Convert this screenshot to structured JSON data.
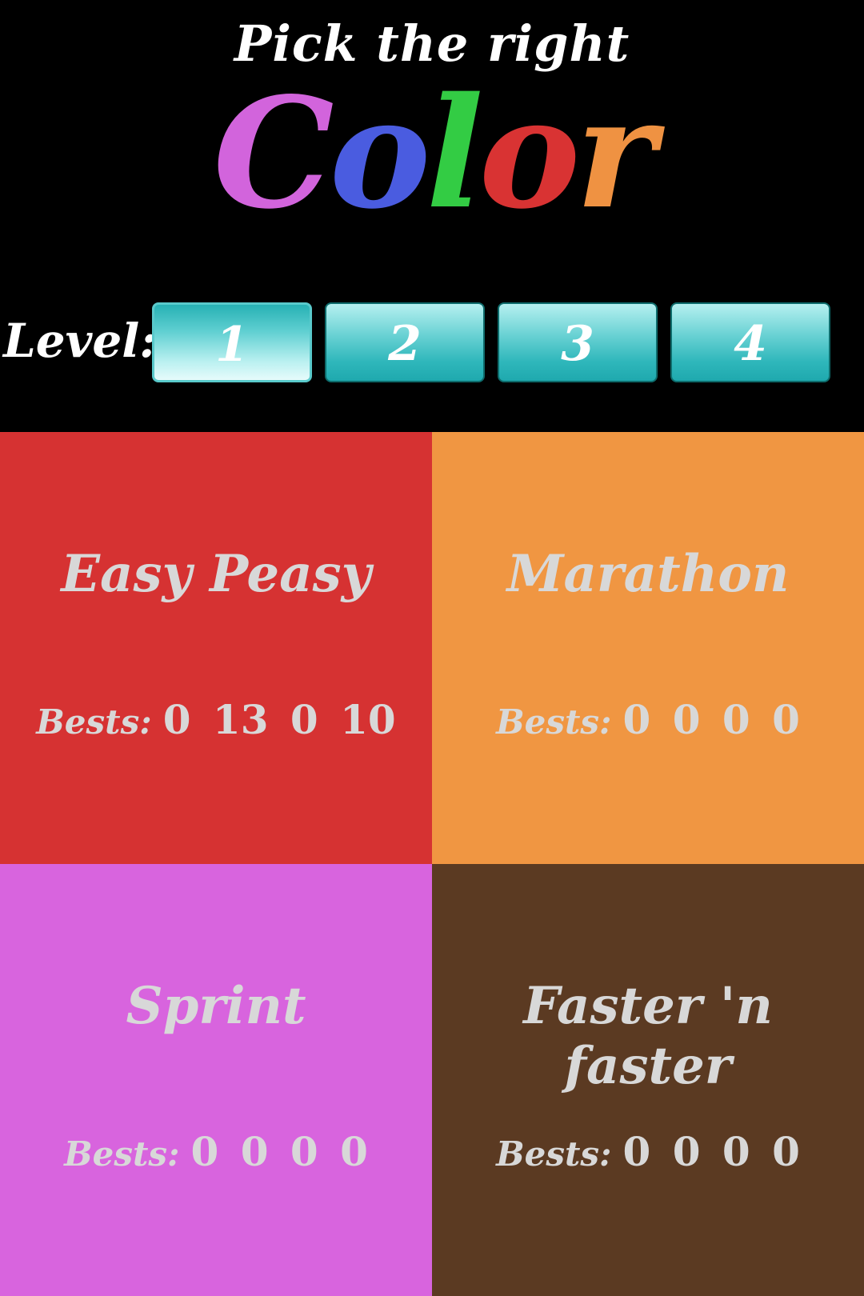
{
  "header": {
    "subtitle": "Pick the right",
    "logo_letters": [
      {
        "char": "C",
        "color": "#d264dc"
      },
      {
        "char": "o",
        "color": "#4a5ce0"
      },
      {
        "char": "l",
        "color": "#33cc44"
      },
      {
        "char": "o",
        "color": "#d93333"
      },
      {
        "char": "r",
        "color": "#ef9242"
      }
    ]
  },
  "level": {
    "label": "Level:",
    "options": [
      "1",
      "2",
      "3",
      "4"
    ],
    "selected": "1"
  },
  "modes": [
    {
      "title": "Easy Peasy",
      "bests_label": "Bests:",
      "bests": "0 13 0 10",
      "color": "#d63232"
    },
    {
      "title": "Marathon",
      "bests_label": "Bests:",
      "bests": "0 0 0 0",
      "color": "#f09642"
    },
    {
      "title": "Sprint",
      "bests_label": "Bests:",
      "bests": "0 0 0 0",
      "color": "#d864de"
    },
    {
      "title": "Faster 'n faster",
      "bests_label": "Bests:",
      "bests": "0 0 0 0",
      "color": "#5b3a22"
    }
  ]
}
